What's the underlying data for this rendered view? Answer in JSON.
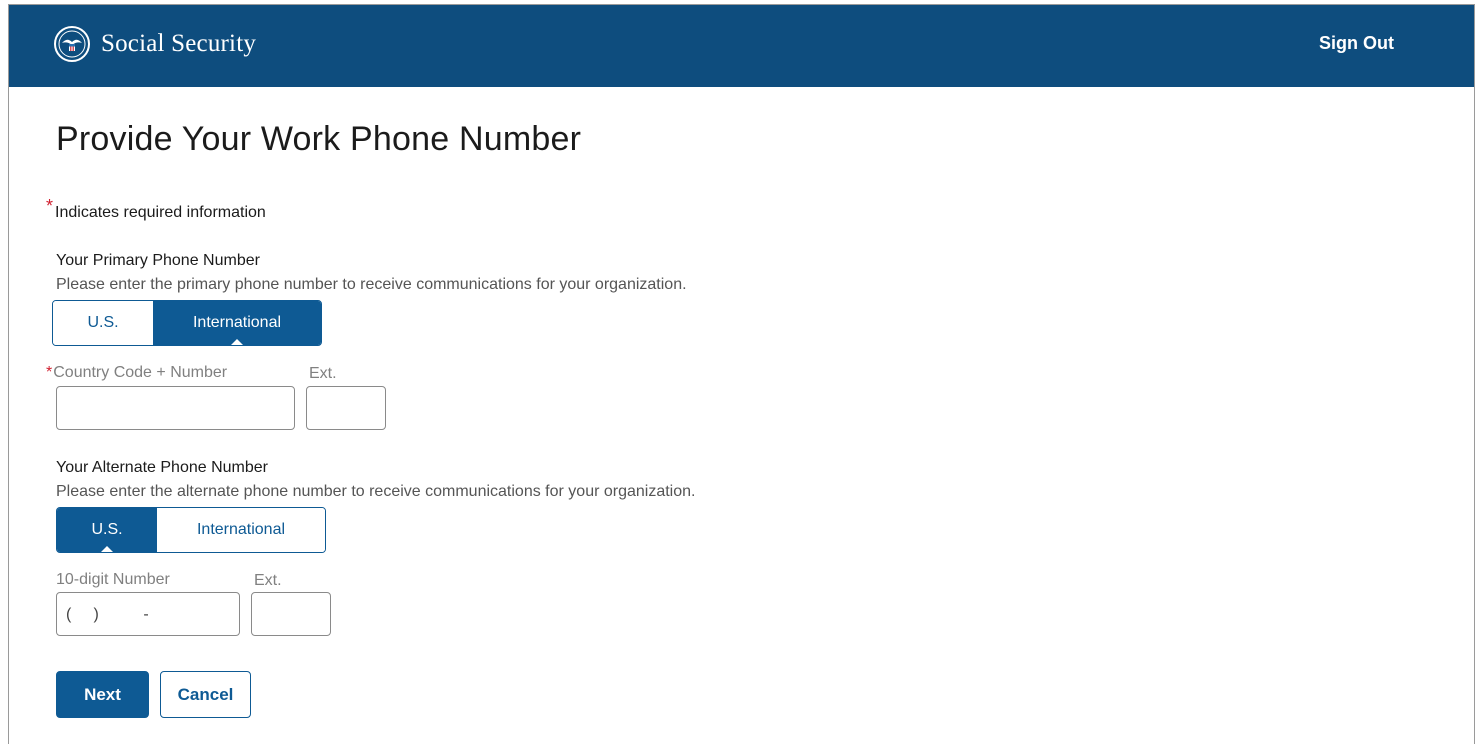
{
  "header": {
    "brand": "Social Security",
    "signout": "Sign Out"
  },
  "page": {
    "title": "Provide Your Work Phone Number",
    "required_note": "Indicates required information"
  },
  "primary": {
    "title": "Your Primary Phone Number",
    "description": "Please enter the primary phone number to receive communications for your organization.",
    "toggle": {
      "us": "U.S.",
      "intl": "International",
      "selected": "International"
    },
    "number_label": "Country Code + Number",
    "ext_label": "Ext.",
    "number_value": "",
    "ext_value": ""
  },
  "alternate": {
    "title": "Your Alternate Phone Number",
    "description": "Please enter the alternate phone number to receive communications for your organization.",
    "toggle": {
      "us": "U.S.",
      "intl": "International",
      "selected": "U.S."
    },
    "number_label": "10-digit Number",
    "ext_label": "Ext.",
    "number_mask": "(     )          -",
    "ext_value": ""
  },
  "actions": {
    "next": "Next",
    "cancel": "Cancel"
  },
  "colors": {
    "header_bg": "#0e4d7e",
    "accent": "#0e5a94",
    "required": "#d01f2f"
  }
}
